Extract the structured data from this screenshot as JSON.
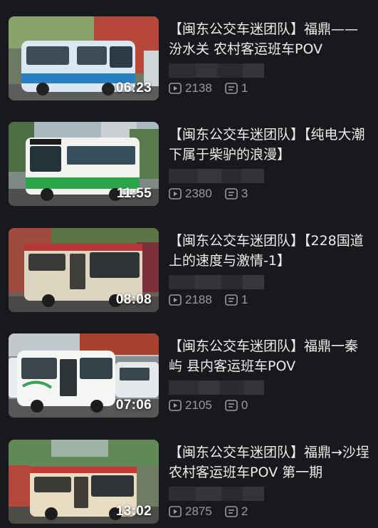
{
  "videos": [
    {
      "title": "【闽东公交车迷团队】福鼎——汾水关 农村客运班车POV",
      "duration": "06:23",
      "plays": "2138",
      "comments": "1",
      "bus_color": "#d9e8f2",
      "stripe_color": "#2a7fc1"
    },
    {
      "title": "【闽东公交车迷团队】【纯电大潮下属于柴驴的浪漫】",
      "duration": "11:55",
      "plays": "2380",
      "comments": "3",
      "bus_color": "#f2f2ee",
      "stripe_color": "#2aa64a"
    },
    {
      "title": "【闽东公交车迷团队】【228国道上的速度与激情-1】",
      "duration": "08:08",
      "plays": "2188",
      "comments": "1",
      "bus_color": "#ded5c0",
      "stripe_color": "#b5373a"
    },
    {
      "title": "【闽东公交车迷团队】福鼎一秦屿 县内客运班车POV",
      "duration": "07:06",
      "plays": "2105",
      "comments": "0",
      "bus_color": "#f4f6f4",
      "stripe_color": "#3fa05a"
    },
    {
      "title": "【闽东公交车迷团队】福鼎→沙埕 农村客运班车POV 第一期",
      "duration": "13:02",
      "plays": "2875",
      "comments": "2",
      "bus_color": "#e8dcc3",
      "stripe_color": "#c23b35"
    }
  ],
  "icons": {
    "play_count": "play-count-icon",
    "comment_count": "comment-count-icon"
  },
  "colors": {
    "background": "#18191c",
    "title": "#ececec",
    "meta": "#9a9a9e"
  }
}
